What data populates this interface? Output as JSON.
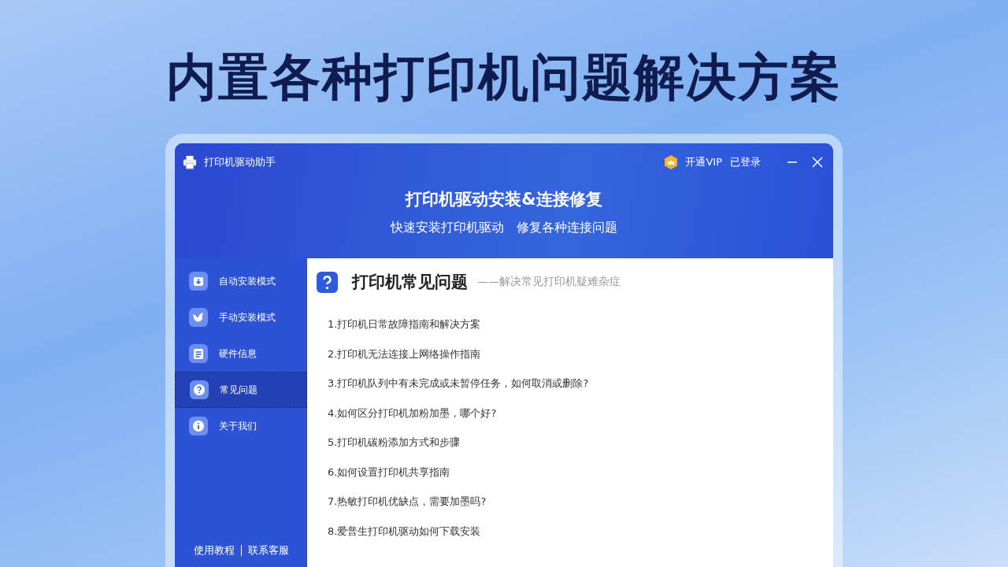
{
  "headline": "内置各种打印机问题解决方案",
  "window": {
    "title": "打印机驱动助手",
    "vip": "开通VIP",
    "login": "已登录"
  },
  "banner": {
    "title": "打印机驱动安装&连接修复",
    "subtitle": "快速安装打印机驱动　修复各种连接问题"
  },
  "sidebar": {
    "items": [
      {
        "label": "自动安装模式",
        "kind": "download",
        "selected": false
      },
      {
        "label": "手动安装模式",
        "kind": "bird",
        "selected": false
      },
      {
        "label": "硬件信息",
        "kind": "list",
        "selected": false
      },
      {
        "label": "常见问题",
        "kind": "question",
        "selected": true
      },
      {
        "label": "关于我们",
        "kind": "info",
        "selected": false
      }
    ],
    "links": [
      "使用教程",
      "联系客服"
    ]
  },
  "content": {
    "title": "打印机常见问题",
    "subtitle": "——解决常见打印机疑难杂症",
    "items": [
      "1.打印机日常故障指南和解决方案",
      "2.打印机无法连接上网络操作指南",
      "3.打印机队列中有未完成或未暂停任务，如何取消或删除?",
      "4.如何区分打印机加粉加墨，哪个好?",
      "5.打印机碳粉添加方式和步骤",
      "6.如何设置打印机共享指南",
      "7.热敏打印机优缺点，需要加墨吗?",
      "8.爱普生打印机驱动如何下载安装"
    ]
  }
}
